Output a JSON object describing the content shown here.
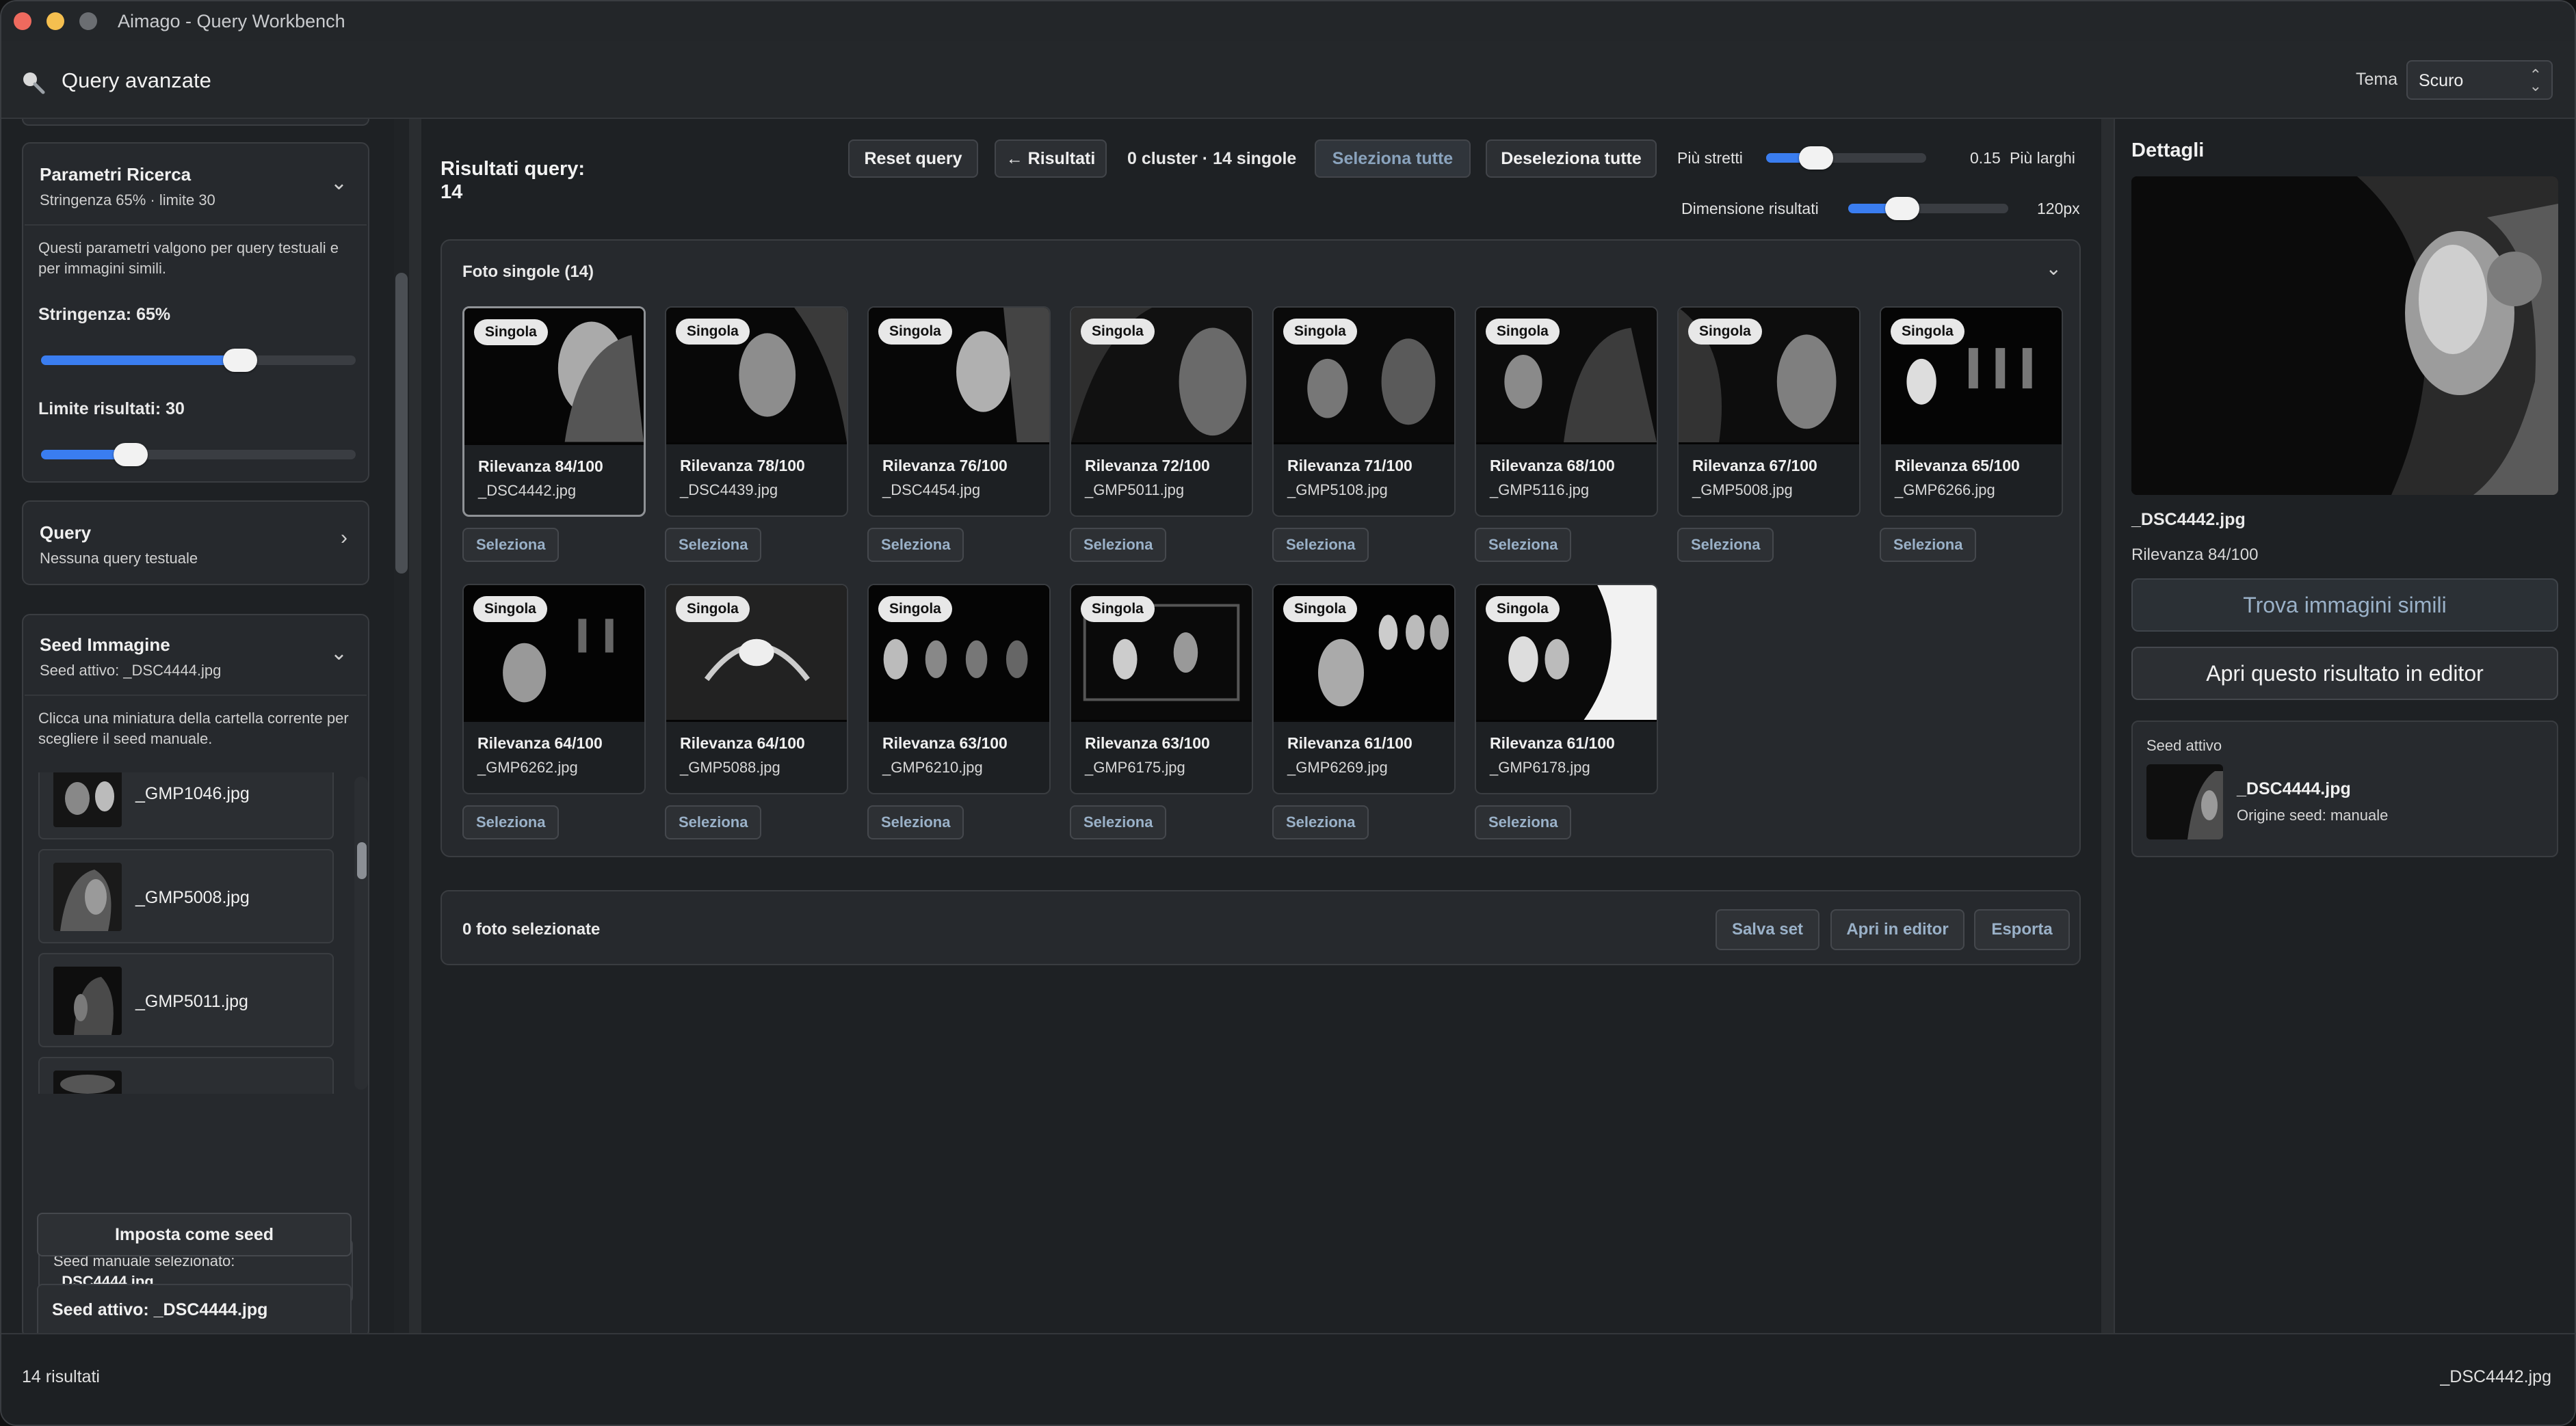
{
  "window": {
    "title": "Aimago - Query Workbench"
  },
  "header": {
    "title": "Query avanzate",
    "theme_label": "Tema",
    "theme_value": "Scuro"
  },
  "sidebar": {
    "params": {
      "title": "Parametri Ricerca",
      "subtitle": "Stringenza 65% · limite 30",
      "description": "Questi parametri valgono per query testuali e per immagini simili.",
      "strictness_label": "Stringenza: 65%",
      "strictness_value": 0.65,
      "limit_label": "Limite risultati: 30",
      "limit_value": 30
    },
    "query": {
      "title": "Query",
      "subtitle": "Nessuna query testuale"
    },
    "seed": {
      "title": "Seed Immagine",
      "subtitle": "Seed attivo: _DSC4444.jpg",
      "description": "Clicca una miniatura della cartella corrente per scegliere il seed manuale.",
      "items": [
        {
          "name": "_GMP1046.jpg"
        },
        {
          "name": "_GMP5008.jpg"
        },
        {
          "name": "_GMP5011.jpg"
        }
      ],
      "manual_label": "Seed manuale selezionato:",
      "manual_value": "_DSC4444.jpg",
      "set_button": "Imposta come seed",
      "active_label": "Seed attivo: _DSC4444.jpg"
    }
  },
  "toolbar": {
    "results_title": "Risultati query:",
    "results_count": "14",
    "reset": "Reset query",
    "back": "← Risultati",
    "summary": "0 cluster · 14 singole",
    "select_all": "Seleziona tutte",
    "deselect_all": "Deseleziona tutte",
    "narrow_label": "Più stretti",
    "cluster_value": "0.15",
    "wide_label": "Più larghi",
    "size_label": "Dimensione risultati",
    "size_value": "120px"
  },
  "grid": {
    "title": "Foto singole (14)",
    "badge": "Singola",
    "select_label": "Seleziona",
    "cards": [
      {
        "relevance": "Rilevanza 84/100",
        "file": "_DSC4442.jpg"
      },
      {
        "relevance": "Rilevanza 78/100",
        "file": "_DSC4439.jpg"
      },
      {
        "relevance": "Rilevanza 76/100",
        "file": "_DSC4454.jpg"
      },
      {
        "relevance": "Rilevanza 72/100",
        "file": "_GMP5011.jpg"
      },
      {
        "relevance": "Rilevanza 71/100",
        "file": "_GMP5108.jpg"
      },
      {
        "relevance": "Rilevanza 68/100",
        "file": "_GMP5116.jpg"
      },
      {
        "relevance": "Rilevanza 67/100",
        "file": "_GMP5008.jpg"
      },
      {
        "relevance": "Rilevanza 65/100",
        "file": "_GMP6266.jpg"
      },
      {
        "relevance": "Rilevanza 64/100",
        "file": "_GMP6262.jpg"
      },
      {
        "relevance": "Rilevanza 64/100",
        "file": "_GMP5088.jpg"
      },
      {
        "relevance": "Rilevanza 63/100",
        "file": "_GMP6210.jpg"
      },
      {
        "relevance": "Rilevanza 63/100",
        "file": "_GMP6175.jpg"
      },
      {
        "relevance": "Rilevanza 61/100",
        "file": "_GMP6269.jpg"
      },
      {
        "relevance": "Rilevanza 61/100",
        "file": "_GMP6178.jpg"
      }
    ]
  },
  "selection": {
    "count_text": "0 foto selezionate",
    "save": "Salva set",
    "open_editor": "Apri in editor",
    "export": "Esporta"
  },
  "details": {
    "title": "Dettagli",
    "file": "_DSC4442.jpg",
    "relevance": "Rilevanza 84/100",
    "find_similar": "Trova immagini simili",
    "open_result": "Apri questo risultato in editor",
    "seed_box_title": "Seed attivo",
    "seed_file": "_DSC4444.jpg",
    "seed_origin": "Origine seed: manuale"
  },
  "status": {
    "left": "14 risultati",
    "right": "_DSC4442.jpg"
  },
  "colors": {
    "accent": "#3a7df0",
    "background": "#1e2124",
    "panel": "#26292d"
  }
}
